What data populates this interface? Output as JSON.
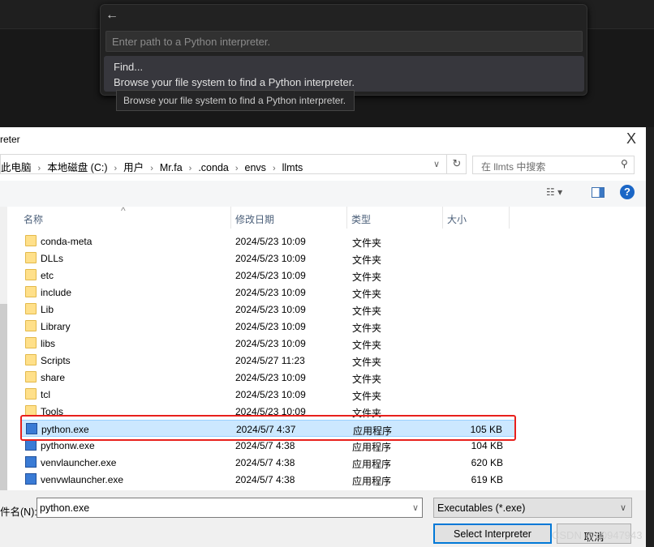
{
  "palette": {
    "back_icon": "arrow-left-icon",
    "placeholder": "Enter path to a Python interpreter.",
    "item_title": "Find...",
    "item_desc": "Browse your file system to find a Python interpreter.",
    "tooltip": "Browse your file system to find a Python interpreter."
  },
  "dialog": {
    "title": "reter",
    "close": "X",
    "breadcrumb": [
      "此电脑",
      "本地磁盘 (C:)",
      "用户",
      "Mr.fa",
      ".conda",
      "envs",
      "llmts"
    ],
    "search_placeholder": "在 llmts 中搜索",
    "columns": {
      "name": "名称",
      "date": "修改日期",
      "type": "类型",
      "size": "大小"
    },
    "files": [
      {
        "name": "conda-meta",
        "date": "2024/5/23 10:09",
        "type": "文件夹",
        "size": "",
        "kind": "folder"
      },
      {
        "name": "DLLs",
        "date": "2024/5/23 10:09",
        "type": "文件夹",
        "size": "",
        "kind": "folder"
      },
      {
        "name": "etc",
        "date": "2024/5/23 10:09",
        "type": "文件夹",
        "size": "",
        "kind": "folder"
      },
      {
        "name": "include",
        "date": "2024/5/23 10:09",
        "type": "文件夹",
        "size": "",
        "kind": "folder"
      },
      {
        "name": "Lib",
        "date": "2024/5/23 10:09",
        "type": "文件夹",
        "size": "",
        "kind": "folder"
      },
      {
        "name": "Library",
        "date": "2024/5/23 10:09",
        "type": "文件夹",
        "size": "",
        "kind": "folder"
      },
      {
        "name": "libs",
        "date": "2024/5/23 10:09",
        "type": "文件夹",
        "size": "",
        "kind": "folder"
      },
      {
        "name": "Scripts",
        "date": "2024/5/27 11:23",
        "type": "文件夹",
        "size": "",
        "kind": "folder"
      },
      {
        "name": "share",
        "date": "2024/5/23 10:09",
        "type": "文件夹",
        "size": "",
        "kind": "folder"
      },
      {
        "name": "tcl",
        "date": "2024/5/23 10:09",
        "type": "文件夹",
        "size": "",
        "kind": "folder"
      },
      {
        "name": "Tools",
        "date": "2024/5/23 10:09",
        "type": "文件夹",
        "size": "",
        "kind": "folder"
      },
      {
        "name": "python.exe",
        "date": "2024/5/7 4:37",
        "type": "应用程序",
        "size": "105 KB",
        "kind": "exe",
        "selected": true
      },
      {
        "name": "pythonw.exe",
        "date": "2024/5/7 4:38",
        "type": "应用程序",
        "size": "104 KB",
        "kind": "exe"
      },
      {
        "name": "venvlauncher.exe",
        "date": "2024/5/7 4:38",
        "type": "应用程序",
        "size": "620 KB",
        "kind": "exe"
      },
      {
        "name": "venvwlauncher.exe",
        "date": "2024/5/7 4:38",
        "type": "应用程序",
        "size": "619 KB",
        "kind": "exe"
      }
    ],
    "filename_label": "件名(N):",
    "filename_value": "python.exe",
    "filter": "Executables (*.exe)",
    "select_button": "Select Interpreter",
    "cancel_button": "取消"
  },
  "watermark": "CSDN @u0947943",
  "colors": {
    "selection": "#cce8ff",
    "highlight_box": "#e8201c",
    "accent": "#0078d7"
  }
}
